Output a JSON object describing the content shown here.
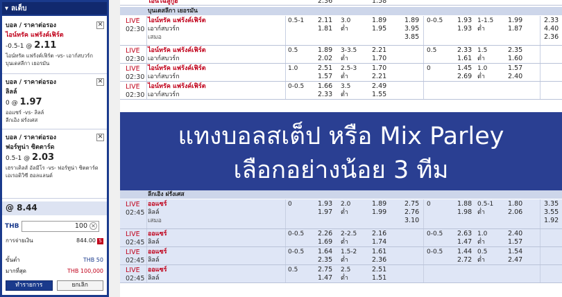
{
  "slip": {
    "title": "ลเต็บ",
    "bets": [
      {
        "type": "บอล / ราคาต่อรอง",
        "team": "ไอน์ทรัค แฟร้งค์เฟิร์ต",
        "line": "-0.5-1 @",
        "odds": "2.11",
        "match": "ไอน์ทรัค แฟร้งค์เฟิร์ต -vs- เอาก์สบวร์ก",
        "league": "บุนเดสลีกา เยอรมัน"
      },
      {
        "type": "บอล / ราคาต่อรอง",
        "team": "ลิลล์",
        "line": "0 @",
        "odds": "1.97",
        "match": "ออแซร์ -vs- ลิลล์",
        "league": "ลีกเอิง ฝรั่งเศส"
      },
      {
        "type": "บอล / ราคาต่อรอง",
        "team": "ฟอร์ทูน่า ซิตตาร์ด",
        "line": "0.5-1 @",
        "odds": "2.03",
        "match": "เฮราเคิลส์ อัลมีโร -vs- ฟอร์ทูน่า ซิตตาร์ด",
        "league": "เอเรอดิวิซี ฮอลแลนด์"
      }
    ],
    "total_odds": "@ 8.44",
    "currency": "THB",
    "stake": "100",
    "payout_label": "การจ่ายเงิน",
    "payout_value": "844.00",
    "payout_icon": "S",
    "min_label": "ขั้นต่ำ",
    "min_value": "THB 50",
    "max_label": "มากที่สุด",
    "max_value": "THB 100,000",
    "confirm_label": "ทำรายการ",
    "cancel_label": "ยกเลิก"
  },
  "odds": {
    "top_row": {
      "home": "ไอน์โฉลูกูฮ",
      "o1": "2.36",
      "o2": "1.58"
    },
    "leagues": [
      {
        "name": "บุนเดสลีกา เยอรมัน",
        "rows": [
          {
            "live": "LIVE",
            "time": "02:30",
            "home": "ไอน์ทรัค แฟร้งค์เฟิร์ต",
            "away": "เอาก์สบวร์ก",
            "draw": "เสมอ",
            "h1": "0.5-1",
            "o1a": "2.11",
            "o1b": "1.81",
            "h2": "3.0",
            "h2b": "ต่ำ",
            "o2a": "1.89",
            "o2b": "1.95",
            "x1": "1.89",
            "x2": "3.95",
            "x3": "3.85",
            "h3": "0-0.5",
            "o3a": "1.93",
            "o3b": "1.93",
            "h4": "1-1.5",
            "h4b": "ต่ำ",
            "o4a": "1.99",
            "o4b": "1.87",
            "y1": "2.33",
            "y2": "4.40",
            "y3": "2.36"
          },
          {
            "live": "LIVE",
            "time": "02:30",
            "home": "ไอน์ทรัค แฟร้งค์เฟิร์ต",
            "away": "เอาก์สบวร์ก",
            "draw": "",
            "h1": "0.5",
            "o1a": "1.89",
            "o1b": "2.02",
            "h2": "3-3.5",
            "h2b": "ต่ำ",
            "o2a": "2.21",
            "o2b": "1.70",
            "x1": "",
            "x2": "",
            "x3": "",
            "h3": "0.5",
            "o3a": "2.33",
            "o3b": "1.61",
            "h4": "1.5",
            "h4b": "ต่ำ",
            "o4a": "2.35",
            "o4b": "1.60",
            "y1": "",
            "y2": "",
            "y3": ""
          },
          {
            "live": "LIVE",
            "time": "02:30",
            "home": "ไอน์ทรัค แฟร้งค์เฟิร์ต",
            "away": "เอาก์สบวร์ก",
            "draw": "",
            "h1": "1.0",
            "o1a": "2.51",
            "o1b": "1.57",
            "h2": "2.5-3",
            "h2b": "ต่ำ",
            "o2a": "1.70",
            "o2b": "2.21",
            "x1": "",
            "x2": "",
            "x3": "",
            "h3": "0",
            "o3a": "1.45",
            "o3b": "2.69",
            "h4": "1.0",
            "h4b": "ต่ำ",
            "o4a": "1.57",
            "o4b": "2.40",
            "y1": "",
            "y2": "",
            "y3": ""
          },
          {
            "live": "LIVE",
            "time": "02:30",
            "home": "ไอน์ทรัค แฟร้งค์เฟิร์ต",
            "away": "เอาก์สบวร์ก",
            "draw": "",
            "h1": "0-0.5",
            "o1a": "1.66",
            "o1b": "2.33",
            "h2": "3.5",
            "h2b": "ต่ำ",
            "o2a": "2.49",
            "o2b": "1.55",
            "x1": "",
            "x2": "",
            "x3": "",
            "h3": "",
            "o3a": "",
            "o3b": "",
            "h4": "",
            "h4b": "",
            "o4a": "",
            "o4b": "",
            "y1": "",
            "y2": "",
            "y3": ""
          }
        ]
      },
      {
        "name": "ลีกเอิง ฝรั่งเศส",
        "rows": [
          {
            "live": "LIVE",
            "time": "02:45",
            "home": "ออแซร์",
            "away": "ลิลล์",
            "draw": "เสมอ",
            "h1": "0",
            "o1a": "1.93",
            "o1b": "1.97",
            "h2": "2.0",
            "h2b": "ต่ำ",
            "o2a": "1.89",
            "o2b": "1.99",
            "x1": "2.75",
            "x2": "2.76",
            "x3": "3.10",
            "h3": "0",
            "o3a": "1.88",
            "o3b": "1.98",
            "h4": "0.5-1",
            "h4b": "ต่ำ",
            "o4a": "1.80",
            "o4b": "2.06",
            "y1": "3.35",
            "y2": "3.55",
            "y3": "1.92"
          },
          {
            "live": "LIVE",
            "time": "02:45",
            "home": "ออแซร์",
            "away": "ลิลล์",
            "draw": "",
            "h1": "0-0.5",
            "o1a": "2.26",
            "o1b": "1.69",
            "h2": "2-2.5",
            "h2b": "ต่ำ",
            "o2a": "2.16",
            "o2b": "1.74",
            "x1": "",
            "x2": "",
            "x3": "",
            "h3": "0-0.5",
            "o3a": "2.63",
            "o3b": "1.47",
            "h4": "1.0",
            "h4b": "ต่ำ",
            "o4a": "2.40",
            "o4b": "1.57",
            "y1": "",
            "y2": "",
            "y3": ""
          },
          {
            "live": "LIVE",
            "time": "02:45",
            "home": "ออแซร์",
            "away": "ลิลล์",
            "draw": "",
            "h1": "0-0.5",
            "o1a": "1.64",
            "o1b": "2.35",
            "h2": "1.5-2",
            "h2b": "ต่ำ",
            "o2a": "1.61",
            "o2b": "2.36",
            "x1": "",
            "x2": "",
            "x3": "",
            "h3": "0-0.5",
            "o3a": "1.44",
            "o3b": "2.72",
            "h4": "0.5",
            "h4b": "ต่ำ",
            "o4a": "1.54",
            "o4b": "2.47",
            "y1": "",
            "y2": "",
            "y3": ""
          },
          {
            "live": "LIVE",
            "time": "02:45",
            "home": "ออแซร์",
            "away": "ลิลล์",
            "draw": "",
            "h1": "0.5",
            "o1a": "2.75",
            "o1b": "1.47",
            "h2": "2.5",
            "h2b": "ต่ำ",
            "o2a": "2.51",
            "o2b": "1.51",
            "x1": "",
            "x2": "",
            "x3": "",
            "h3": "",
            "o3a": "",
            "o3b": "",
            "h4": "",
            "h4b": "",
            "o4a": "",
            "o4b": "",
            "y1": "",
            "y2": "",
            "y3": ""
          }
        ]
      }
    ]
  },
  "banner": {
    "line1": "แทงบอลสเต็ป หรือ Mix Parley",
    "line2": "เลือกอย่างน้อย 3 ทีม"
  },
  "colors": {
    "brand": "#1a3a8c",
    "live_red": "#c0001a",
    "banner_bg": "#2a3f92"
  }
}
